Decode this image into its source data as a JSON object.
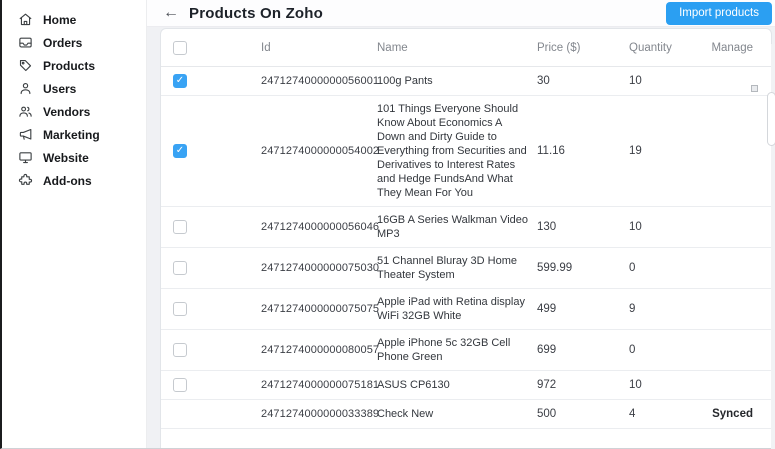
{
  "sidebar": {
    "items": [
      {
        "label": "Home",
        "icon": "home-icon"
      },
      {
        "label": "Orders",
        "icon": "orders-inbox-icon"
      },
      {
        "label": "Products",
        "icon": "product-tag-icon"
      },
      {
        "label": "Users",
        "icon": "user-icon"
      },
      {
        "label": "Vendors",
        "icon": "vendors-people-icon"
      },
      {
        "label": "Marketing",
        "icon": "megaphone-icon"
      },
      {
        "label": "Website",
        "icon": "monitor-icon"
      },
      {
        "label": "Add-ons",
        "icon": "puzzle-icon"
      }
    ]
  },
  "header": {
    "back_arrow": "←",
    "title": "Products On Zoho",
    "import_button": "Import products"
  },
  "table": {
    "columns": [
      "Id",
      "Name",
      "Price ($)",
      "Quantity",
      "Manage"
    ],
    "rows": [
      {
        "has_checkbox": true,
        "checked": true,
        "id": "2471274000000056001",
        "name": "100g Pants",
        "price": "30",
        "quantity": "10",
        "manage": ""
      },
      {
        "has_checkbox": true,
        "checked": true,
        "id": "2471274000000054002",
        "name": "101 Things Everyone Should Know About Economics A Down and Dirty Guide to Everything from Securities and Derivatives to Interest Rates and Hedge FundsAnd What They Mean For You",
        "price": "11.16",
        "quantity": "19",
        "manage": ""
      },
      {
        "has_checkbox": true,
        "checked": false,
        "id": "2471274000000056046",
        "name": "16GB A Series Walkman Video MP3",
        "price": "130",
        "quantity": "10",
        "manage": ""
      },
      {
        "has_checkbox": true,
        "checked": false,
        "id": "2471274000000075030",
        "name": "51 Channel Bluray 3D Home Theater System",
        "price": "599.99",
        "quantity": "0",
        "manage": ""
      },
      {
        "has_checkbox": true,
        "checked": false,
        "id": "2471274000000075075",
        "name": "Apple iPad with Retina display WiFi 32GB White",
        "price": "499",
        "quantity": "9",
        "manage": ""
      },
      {
        "has_checkbox": true,
        "checked": false,
        "id": "2471274000000080057",
        "name": "Apple iPhone 5c 32GB Cell Phone Green",
        "price": "699",
        "quantity": "0",
        "manage": ""
      },
      {
        "has_checkbox": true,
        "checked": false,
        "id": "2471274000000075181",
        "name": "ASUS CP6130",
        "price": "972",
        "quantity": "10",
        "manage": ""
      },
      {
        "has_checkbox": false,
        "checked": false,
        "id": "2471274000000033389",
        "name": "Check New",
        "price": "500",
        "quantity": "4",
        "manage": "Synced"
      }
    ]
  },
  "colors": {
    "accent_blue": "#2b9ff2",
    "checkbox_checked": "#39a3f4",
    "header_text": "#83878e",
    "body_text": "#3b3e45"
  }
}
